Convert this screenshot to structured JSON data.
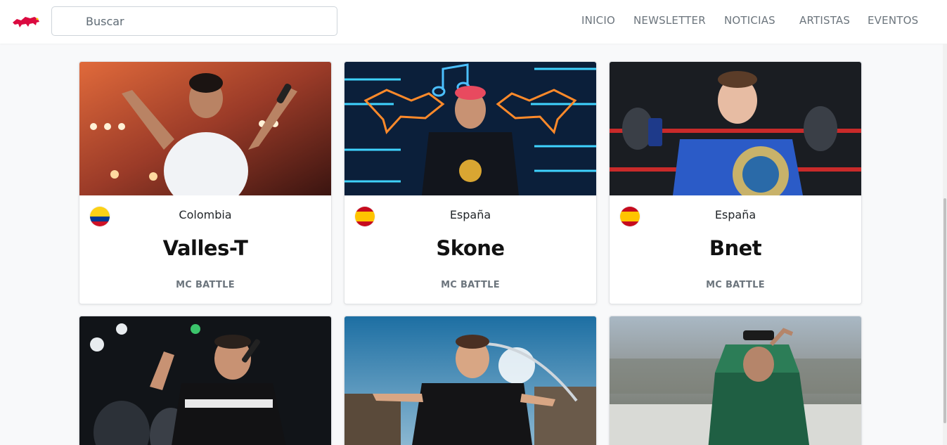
{
  "search": {
    "placeholder": "Buscar"
  },
  "nav": {
    "items": [
      {
        "label": "INICIO"
      },
      {
        "label": "NEWSLETTER"
      },
      {
        "label": "NOTICIAS"
      },
      {
        "label": "ARTISTAS"
      },
      {
        "label": "EVENTOS"
      }
    ]
  },
  "artists": [
    {
      "country": "Colombia",
      "flag": "colombia",
      "name": "Valles-T",
      "category": "MC BATTLE"
    },
    {
      "country": "España",
      "flag": "spain",
      "name": "Skone",
      "category": "MC BATTLE"
    },
    {
      "country": "España",
      "flag": "spain",
      "name": "Bnet",
      "category": "MC BATTLE"
    },
    {
      "country": "",
      "flag": "",
      "name": "",
      "category": ""
    },
    {
      "country": "",
      "flag": "",
      "name": "",
      "category": ""
    },
    {
      "country": "",
      "flag": "",
      "name": "",
      "category": ""
    }
  ],
  "colors": {
    "brand_red": "#db0a40",
    "brand_yellow": "#ffc906",
    "nav_text": "#6c757d"
  }
}
